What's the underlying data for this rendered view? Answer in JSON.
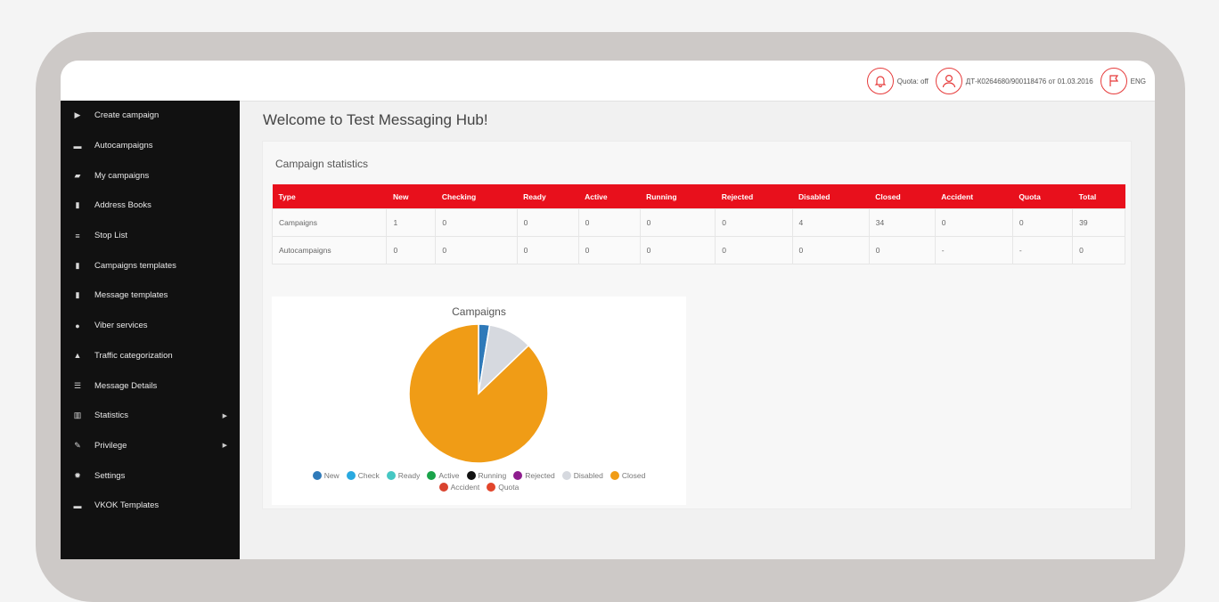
{
  "topbar": {
    "quota_text": "Quota: off",
    "account_text": "ДТ-К0264680/900118476 от 01.03.2016",
    "lang_text": "ENG"
  },
  "sidebar": {
    "items": [
      {
        "label": "Create campaign",
        "icon": "play-icon"
      },
      {
        "label": "Autocampaigns",
        "icon": "list-icon"
      },
      {
        "label": "My campaigns",
        "icon": "folder-icon"
      },
      {
        "label": "Address Books",
        "icon": "book-icon"
      },
      {
        "label": "Stop List",
        "icon": "ban-list-icon"
      },
      {
        "label": "Campaigns templates",
        "icon": "template-icon"
      },
      {
        "label": "Message templates",
        "icon": "message-template-icon"
      },
      {
        "label": "Viber services",
        "icon": "viber-icon"
      },
      {
        "label": "Traffic categorization",
        "icon": "warning-icon"
      },
      {
        "label": "Message Details",
        "icon": "details-icon"
      },
      {
        "label": "Statistics",
        "icon": "bar-chart-icon",
        "has_submenu": true
      },
      {
        "label": "Privilege",
        "icon": "wrench-icon",
        "has_submenu": true
      },
      {
        "label": "Settings",
        "icon": "gear-icon"
      },
      {
        "label": "VKOK Templates",
        "icon": "list-icon"
      }
    ]
  },
  "main": {
    "title": "Welcome to Test Messaging Hub!",
    "panel_title": "Campaign statistics",
    "table": {
      "headers": [
        "Type",
        "New",
        "Checking",
        "Ready",
        "Active",
        "Running",
        "Rejected",
        "Disabled",
        "Closed",
        "Accident",
        "Quota",
        "Total"
      ],
      "rows": [
        [
          "Campaigns",
          "1",
          "0",
          "0",
          "0",
          "0",
          "0",
          "4",
          "34",
          "0",
          "0",
          "39"
        ],
        [
          "Autocampaigns",
          "0",
          "0",
          "0",
          "0",
          "0",
          "0",
          "0",
          "0",
          "-",
          "-",
          "0"
        ]
      ]
    }
  },
  "chart_data": {
    "type": "pie",
    "title": "Campaigns",
    "categories": [
      "New",
      "Check",
      "Ready",
      "Active",
      "Running",
      "Rejected",
      "Disabled",
      "Closed",
      "Accident",
      "Quota"
    ],
    "values": [
      1,
      0,
      0,
      0,
      0,
      0,
      4,
      34,
      0,
      0
    ],
    "colors": [
      "#2f7ab9",
      "#29a9e0",
      "#46c7c3",
      "#1aa34a",
      "#111111",
      "#8e1d8e",
      "#d6d9df",
      "#f09c16",
      "#d9432f",
      "#e2452b"
    ],
    "legend": "bottom"
  },
  "colors": {
    "accent_red": "#e8101c",
    "sidebar_bg": "#111111",
    "icon_red": "#e63b3b"
  }
}
